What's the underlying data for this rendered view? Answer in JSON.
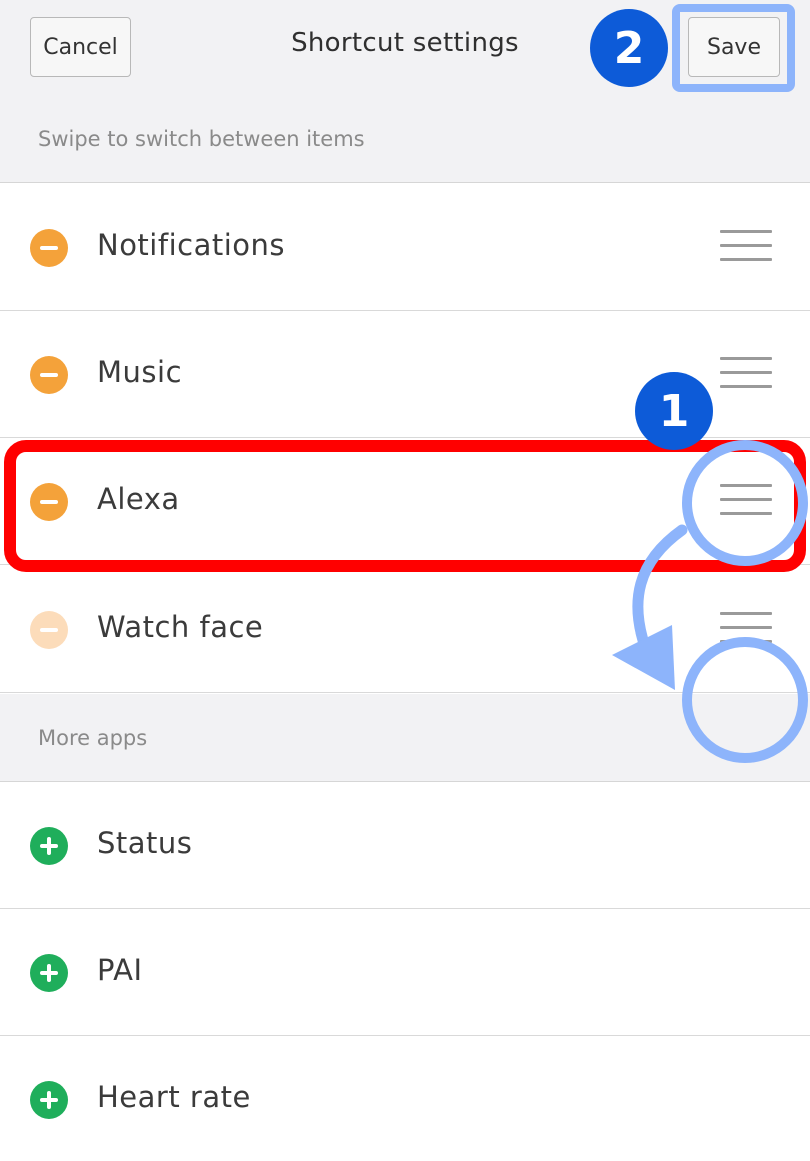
{
  "header": {
    "cancel_label": "Cancel",
    "title": "Shortcut settings",
    "save_label": "Save"
  },
  "sections": {
    "current_hint": "Swipe to switch between items",
    "more_apps": "More apps"
  },
  "current_items": [
    {
      "label": "Notifications",
      "icon": "minus-circle-icon"
    },
    {
      "label": "Music",
      "icon": "minus-circle-icon"
    },
    {
      "label": "Alexa",
      "icon": "minus-circle-icon"
    },
    {
      "label": "Watch face",
      "icon": "minus-circle-icon"
    }
  ],
  "more_items": [
    {
      "label": "Status",
      "icon": "plus-circle-icon"
    },
    {
      "label": "PAI",
      "icon": "plus-circle-icon"
    },
    {
      "label": "Heart rate",
      "icon": "plus-circle-icon"
    }
  ],
  "annotations": {
    "step1": "1",
    "step2": "2",
    "badge_color": "#0d5bd8",
    "highlight_color": "#ff0000",
    "pointer_color": "#8db4fb"
  },
  "colors": {
    "remove": "#f4a23a",
    "add": "#1fae5b"
  }
}
